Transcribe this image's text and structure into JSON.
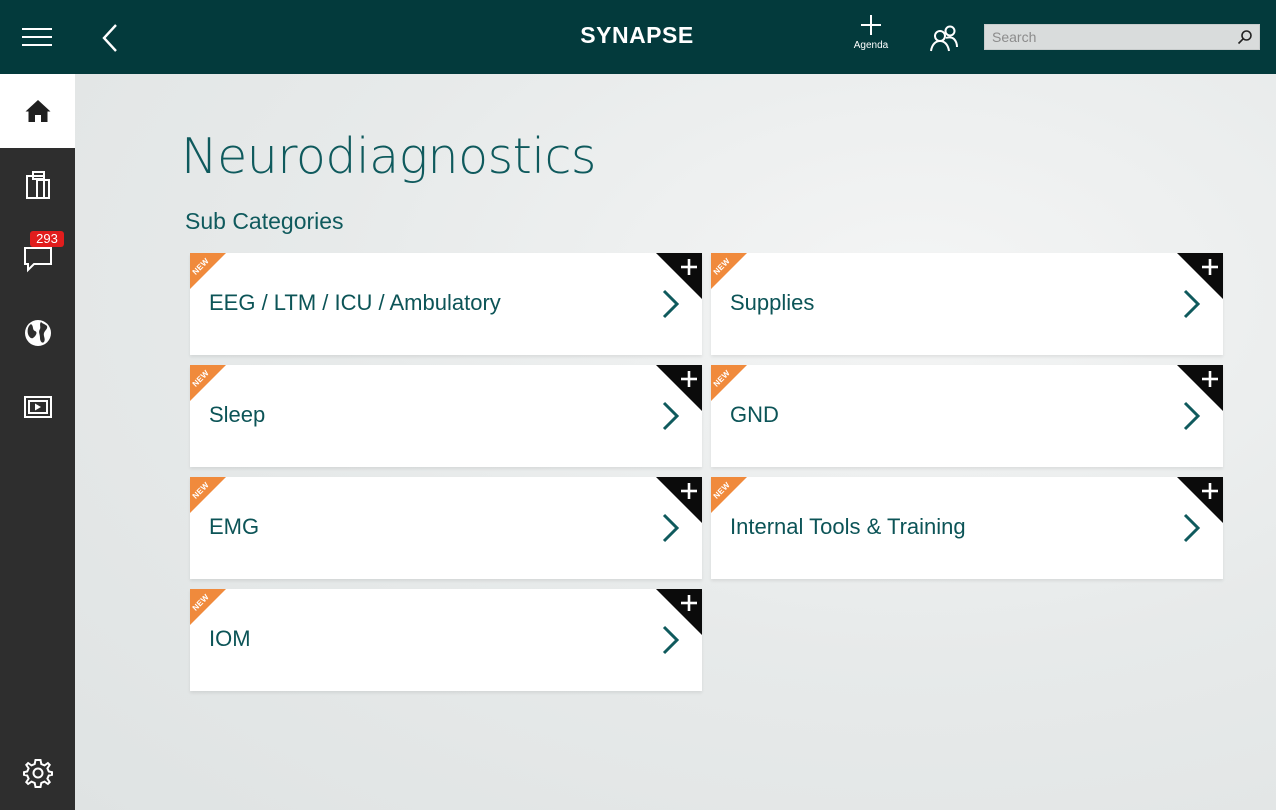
{
  "app": {
    "brand": "SYNAPSE",
    "agenda_label": "Agenda",
    "search_placeholder": "Search"
  },
  "sidebar": {
    "items": [
      {
        "name": "home",
        "icon": "home-icon",
        "active": true
      },
      {
        "name": "clipboard",
        "icon": "clipboard-icon"
      },
      {
        "name": "messages",
        "icon": "chat-icon"
      },
      {
        "name": "globe",
        "icon": "globe-icon",
        "badge": "293"
      },
      {
        "name": "media",
        "icon": "video-icon"
      },
      {
        "name": "settings",
        "icon": "gear-icon"
      }
    ]
  },
  "main": {
    "title": "Neurodiagnostics",
    "section_title": "Sub Categories",
    "new_label": "NEW",
    "tiles": [
      {
        "label": "EEG / LTM / ICU / Ambulatory"
      },
      {
        "label": "Supplies"
      },
      {
        "label": "Sleep"
      },
      {
        "label": "GND"
      },
      {
        "label": "EMG"
      },
      {
        "label": "Internal Tools & Training"
      },
      {
        "label": "IOM"
      }
    ]
  },
  "colors": {
    "topbar": "#033a3c",
    "sidebar": "#2e2e2e",
    "accent_text": "#0f5a5d",
    "new_ribbon": "#f08a3c",
    "badge": "#e11d1d"
  }
}
